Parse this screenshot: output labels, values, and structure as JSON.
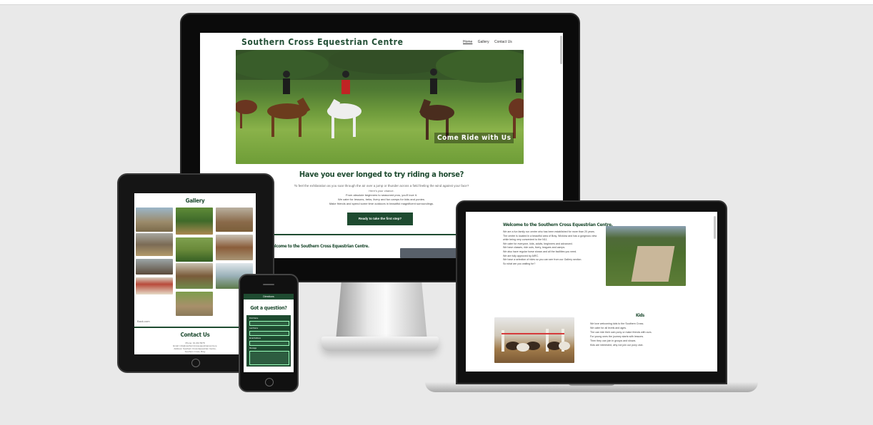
{
  "site": {
    "title": "Southern Cross Equestrian Centre",
    "nav": [
      "Home",
      "Gallery",
      "Contact Us"
    ]
  },
  "hero": {
    "overlay": "Come Ride with Us",
    "heading": "Have you ever longed to try riding a horse?",
    "lead": "To feel the exhilaration as you soar through the air over a jump or thunder across a field feeling the wind against your face?",
    "chance": "Here's your chance.",
    "lines": [
      "From absolute beginners to seasoned pros, you'll love it.",
      "We cater for lessons, treks, livery and fun camps for kids and ponies.",
      "Make friends and spend some time outdoors in beautiful magnificent surroundings."
    ],
    "cta": "Ready to take the first step?"
  },
  "welcome": {
    "heading": "Welcome to the Southern Cross Equestrian Centre.",
    "paragraphs": [
      "We are a fun family run centre who has been established for more than 20 years.",
      "The centre is located in a beautiful area of Bray, Wicklow and has a gorgeous view while being very convenient to the N11.",
      "We cater for everyone, kids, adults, beginners and advanced.",
      "We have classes, ride outs, livery, leagues and camps.",
      "We also have regular horse shows and all the facilities you need.",
      "We are fully approved by AIRC.",
      "We have a selection of rides so you can see from our Gallery section.",
      "So what are you waiting for?"
    ]
  },
  "kids": {
    "heading": "Kids",
    "lines": [
      "We love welcoming kids to the Southern Cross.",
      "We cater for all levels and ages.",
      "The can ride their own pony or make friends with ours.",
      "For young ones the journey starts with lessons.",
      "Then they can join in groups and shows.",
      "Kids are interested, why not join our pony club."
    ]
  },
  "gallery": {
    "heading": "Gallery",
    "footer_note": "Back.com"
  },
  "contact": {
    "heading": "Contact Us",
    "lines": [
      "Phone: 01 234 5678",
      "Email: info@southerncrossequestriancentre.ie",
      "Address: Southern Cross Equestrian Centre,",
      "Southern Cross, Bray"
    ]
  },
  "phone_view": {
    "nav_label": "Directions",
    "heading": "Got a question?",
    "fields": [
      "First Name",
      "Last Name",
      "Email Address",
      "Message"
    ]
  },
  "colors": {
    "brand_green": "#1e4b30",
    "background": "#e9e9e9"
  }
}
